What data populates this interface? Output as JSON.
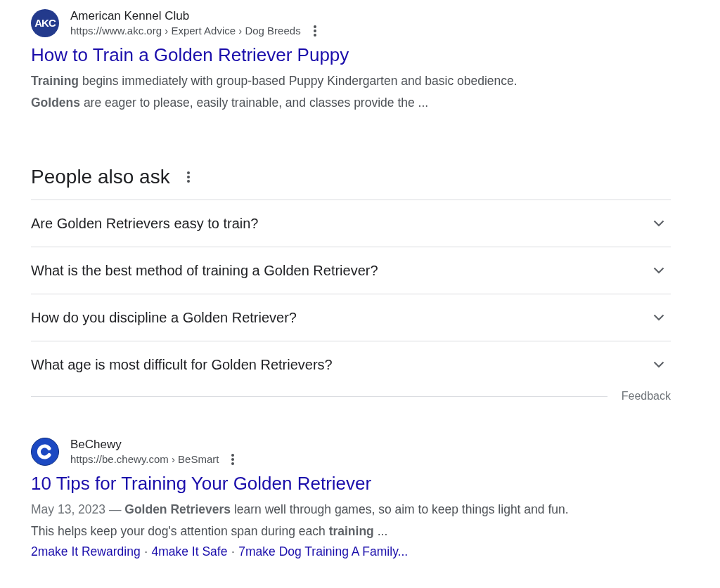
{
  "results": [
    {
      "logo": {
        "kind": "text",
        "text": "AKC"
      },
      "site_name": "American Kennel Club",
      "url": "https://www.akc.org › Expert Advice › Dog Breeds",
      "title": "How to Train a Golden Retriever Puppy",
      "snippet_lines": [
        "**Training** begins immediately with group-based Puppy Kindergarten and basic obedience.",
        "**Goldens** are eager to please, easily trainable, and classes provide the ..."
      ]
    },
    {
      "logo": {
        "kind": "mark"
      },
      "site_name": "BeChewy",
      "url": "https://be.chewy.com › BeSmart",
      "title": "10 Tips for Training Your Golden Retriever",
      "date": "May 13, 2023 —",
      "snippet_lines": [
        "**Golden Retrievers** learn well through games, so aim to keep things light and fun.",
        "This helps keep your dog's attention span during each **training** ..."
      ],
      "sitelink_separator": "·",
      "sitelinks": [
        "2make It Rewarding",
        "4make It Safe",
        "7make Dog Training A Family..."
      ]
    }
  ],
  "people_also_ask": {
    "heading": "People also ask",
    "questions": [
      {
        "text": "Are Golden Retrievers easy to train?",
        "expanded": false
      },
      {
        "text": "What is the best method of training a Golden Retriever?",
        "expanded": false
      },
      {
        "text": "How do you discipline a Golden Retriever?",
        "expanded": false
      },
      {
        "text": "What age is most difficult for Golden Retrievers?",
        "expanded": false
      }
    ],
    "feedback": "Feedback"
  }
}
